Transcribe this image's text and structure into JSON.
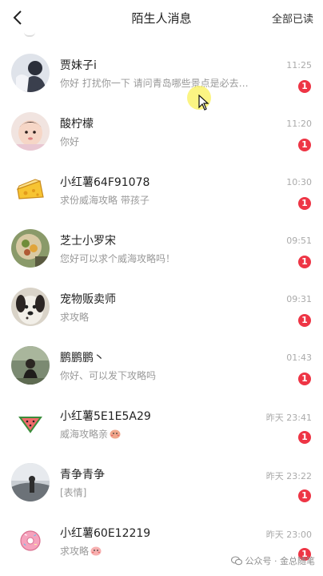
{
  "header": {
    "title": "陌生人消息",
    "mark_all_read": "全部已读"
  },
  "messages": [
    {
      "name": "贾妹子i",
      "preview": "你好 打扰你一下 请问青岛哪些景点是必去…",
      "time": "11:25",
      "badge": "1",
      "avatar": "photo-girl-avatar"
    },
    {
      "name": "酸柠檬",
      "preview": "你好",
      "time": "11:20",
      "badge": "1",
      "avatar": "photo-baby-avatar"
    },
    {
      "name": "小红薯64F91078",
      "preview": "求份威海攻略 带孩子",
      "time": "10:30",
      "badge": "1",
      "avatar": "cheese-avatar"
    },
    {
      "name": "芝士小罗宋",
      "preview": "您好可以求个威海攻略吗！",
      "time": "09:51",
      "badge": "1",
      "avatar": "photo-food-avatar"
    },
    {
      "name": "宠物贩卖师",
      "preview": "求攻略",
      "time": "09:31",
      "badge": "1",
      "avatar": "photo-dog-avatar"
    },
    {
      "name": "鹏鹏鹏丶",
      "preview": "你好、可以发下攻略吗",
      "time": "01:43",
      "badge": "1",
      "avatar": "photo-person-avatar"
    },
    {
      "name": "小红薯5E1E5A29",
      "preview": "威海攻略亲",
      "time": "昨天 23:41",
      "badge": "1",
      "avatar": "watermelon-avatar"
    },
    {
      "name": "青争青争",
      "preview": "[表情]",
      "time": "昨天 23:22",
      "badge": "1",
      "avatar": "photo-landscape-avatar"
    },
    {
      "name": "小红薯60E12219",
      "preview": "求攻略",
      "time": "昨天 23:00",
      "badge": "1",
      "avatar": "donut-avatar"
    }
  ],
  "watermark": "公众号 · 金总随笔",
  "colors": {
    "badge": "#ee3545",
    "time": "#aaaaaa",
    "preview": "#999999"
  }
}
